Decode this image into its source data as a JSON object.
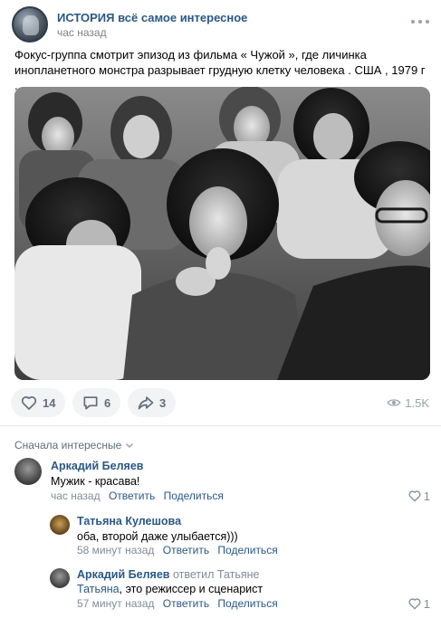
{
  "post": {
    "group_name": "ИСТОРИЯ всё самое интересное",
    "time": "час назад",
    "text": "Фокус-группа смотрит эпизод из фильма « Чужой », где личинка инопланетного монстра разрывает грудную клетку человека . США , 1979 г .",
    "photo_icon": "black-and-white-photo"
  },
  "actions": {
    "likes": "14",
    "comments": "6",
    "shares": "3",
    "views": "1.5K"
  },
  "comments_section": {
    "sort_label": "Сначала интересные",
    "comments": [
      {
        "author": "Аркадий Беляев",
        "text": "Мужик - красава!",
        "time": "час назад",
        "reply_label": "Ответить",
        "share_label": "Поделиться",
        "likes": "1"
      },
      {
        "author": "Татьяна Кулешова",
        "text": "оба, второй даже улыбается)))",
        "time": "58 минут назад",
        "reply_label": "Ответить",
        "share_label": "Поделиться",
        "likes": ""
      },
      {
        "author": "Аркадий Беляев",
        "replied_to": "ответил Татьяне",
        "reply_mention": "Татьяна",
        "text": ", это режиссер и сценарист",
        "time": "57 минут назад",
        "reply_label": "Ответить",
        "share_label": "Поделиться",
        "likes": "1"
      }
    ]
  },
  "colors": {
    "link": "#2a5885",
    "secondary_text": "#818c99",
    "button_bg": "#f2f3f5"
  }
}
